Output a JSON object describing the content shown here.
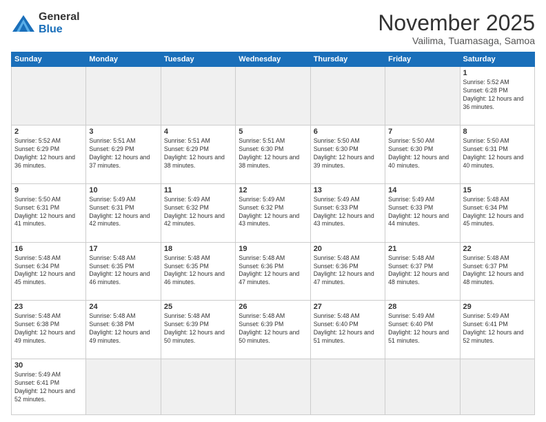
{
  "header": {
    "logo_line1": "General",
    "logo_line2": "Blue",
    "month_year": "November 2025",
    "location": "Vailima, Tuamasaga, Samoa"
  },
  "weekdays": [
    "Sunday",
    "Monday",
    "Tuesday",
    "Wednesday",
    "Thursday",
    "Friday",
    "Saturday"
  ],
  "weeks": [
    [
      {
        "day": "",
        "info": ""
      },
      {
        "day": "",
        "info": ""
      },
      {
        "day": "",
        "info": ""
      },
      {
        "day": "",
        "info": ""
      },
      {
        "day": "",
        "info": ""
      },
      {
        "day": "",
        "info": ""
      },
      {
        "day": "1",
        "info": "Sunrise: 5:52 AM\nSunset: 6:28 PM\nDaylight: 12 hours and 36 minutes."
      }
    ],
    [
      {
        "day": "2",
        "info": "Sunrise: 5:52 AM\nSunset: 6:29 PM\nDaylight: 12 hours and 36 minutes."
      },
      {
        "day": "3",
        "info": "Sunrise: 5:51 AM\nSunset: 6:29 PM\nDaylight: 12 hours and 37 minutes."
      },
      {
        "day": "4",
        "info": "Sunrise: 5:51 AM\nSunset: 6:29 PM\nDaylight: 12 hours and 38 minutes."
      },
      {
        "day": "5",
        "info": "Sunrise: 5:51 AM\nSunset: 6:30 PM\nDaylight: 12 hours and 38 minutes."
      },
      {
        "day": "6",
        "info": "Sunrise: 5:50 AM\nSunset: 6:30 PM\nDaylight: 12 hours and 39 minutes."
      },
      {
        "day": "7",
        "info": "Sunrise: 5:50 AM\nSunset: 6:30 PM\nDaylight: 12 hours and 40 minutes."
      },
      {
        "day": "8",
        "info": "Sunrise: 5:50 AM\nSunset: 6:31 PM\nDaylight: 12 hours and 40 minutes."
      }
    ],
    [
      {
        "day": "9",
        "info": "Sunrise: 5:50 AM\nSunset: 6:31 PM\nDaylight: 12 hours and 41 minutes."
      },
      {
        "day": "10",
        "info": "Sunrise: 5:49 AM\nSunset: 6:31 PM\nDaylight: 12 hours and 42 minutes."
      },
      {
        "day": "11",
        "info": "Sunrise: 5:49 AM\nSunset: 6:32 PM\nDaylight: 12 hours and 42 minutes."
      },
      {
        "day": "12",
        "info": "Sunrise: 5:49 AM\nSunset: 6:32 PM\nDaylight: 12 hours and 43 minutes."
      },
      {
        "day": "13",
        "info": "Sunrise: 5:49 AM\nSunset: 6:33 PM\nDaylight: 12 hours and 43 minutes."
      },
      {
        "day": "14",
        "info": "Sunrise: 5:49 AM\nSunset: 6:33 PM\nDaylight: 12 hours and 44 minutes."
      },
      {
        "day": "15",
        "info": "Sunrise: 5:48 AM\nSunset: 6:34 PM\nDaylight: 12 hours and 45 minutes."
      }
    ],
    [
      {
        "day": "16",
        "info": "Sunrise: 5:48 AM\nSunset: 6:34 PM\nDaylight: 12 hours and 45 minutes."
      },
      {
        "day": "17",
        "info": "Sunrise: 5:48 AM\nSunset: 6:35 PM\nDaylight: 12 hours and 46 minutes."
      },
      {
        "day": "18",
        "info": "Sunrise: 5:48 AM\nSunset: 6:35 PM\nDaylight: 12 hours and 46 minutes."
      },
      {
        "day": "19",
        "info": "Sunrise: 5:48 AM\nSunset: 6:36 PM\nDaylight: 12 hours and 47 minutes."
      },
      {
        "day": "20",
        "info": "Sunrise: 5:48 AM\nSunset: 6:36 PM\nDaylight: 12 hours and 47 minutes."
      },
      {
        "day": "21",
        "info": "Sunrise: 5:48 AM\nSunset: 6:37 PM\nDaylight: 12 hours and 48 minutes."
      },
      {
        "day": "22",
        "info": "Sunrise: 5:48 AM\nSunset: 6:37 PM\nDaylight: 12 hours and 48 minutes."
      }
    ],
    [
      {
        "day": "23",
        "info": "Sunrise: 5:48 AM\nSunset: 6:38 PM\nDaylight: 12 hours and 49 minutes."
      },
      {
        "day": "24",
        "info": "Sunrise: 5:48 AM\nSunset: 6:38 PM\nDaylight: 12 hours and 49 minutes."
      },
      {
        "day": "25",
        "info": "Sunrise: 5:48 AM\nSunset: 6:39 PM\nDaylight: 12 hours and 50 minutes."
      },
      {
        "day": "26",
        "info": "Sunrise: 5:48 AM\nSunset: 6:39 PM\nDaylight: 12 hours and 50 minutes."
      },
      {
        "day": "27",
        "info": "Sunrise: 5:48 AM\nSunset: 6:40 PM\nDaylight: 12 hours and 51 minutes."
      },
      {
        "day": "28",
        "info": "Sunrise: 5:49 AM\nSunset: 6:40 PM\nDaylight: 12 hours and 51 minutes."
      },
      {
        "day": "29",
        "info": "Sunrise: 5:49 AM\nSunset: 6:41 PM\nDaylight: 12 hours and 52 minutes."
      }
    ],
    [
      {
        "day": "30",
        "info": "Sunrise: 5:49 AM\nSunset: 6:41 PM\nDaylight: 12 hours and 52 minutes."
      },
      {
        "day": "",
        "info": ""
      },
      {
        "day": "",
        "info": ""
      },
      {
        "day": "",
        "info": ""
      },
      {
        "day": "",
        "info": ""
      },
      {
        "day": "",
        "info": ""
      },
      {
        "day": "",
        "info": ""
      }
    ]
  ]
}
